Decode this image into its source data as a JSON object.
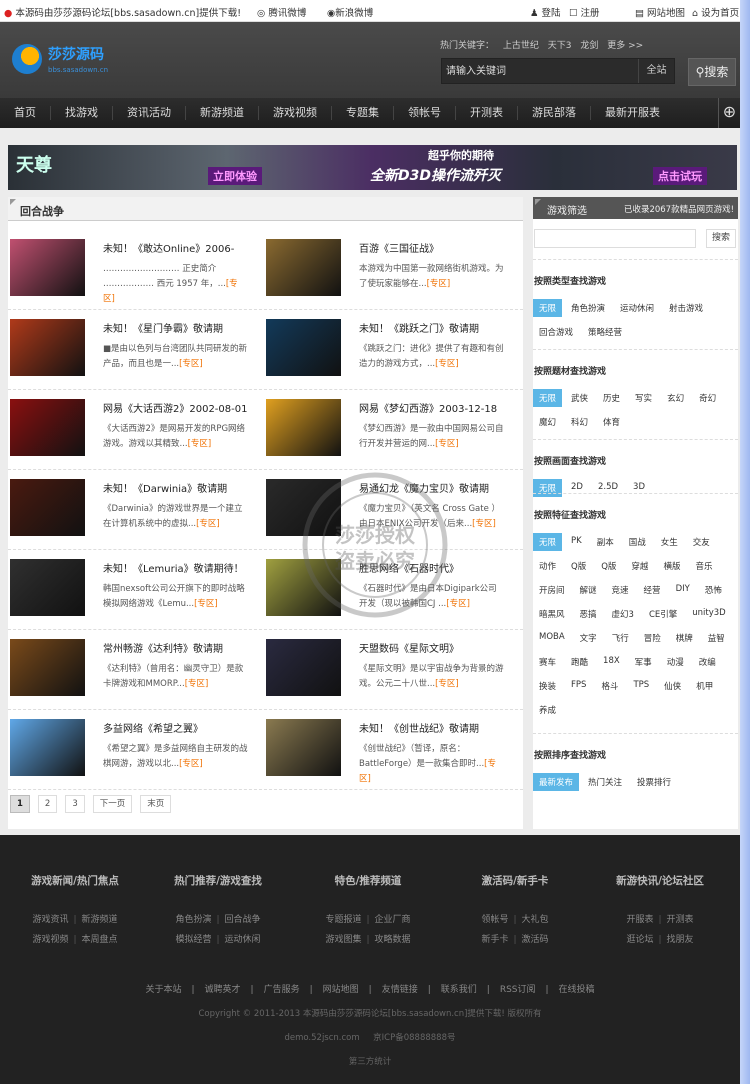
{
  "topbar": {
    "notice": "本源码由莎莎源码论坛[bbs.sasadown.cn]提供下载!",
    "tencent_weibo": "腾讯微博",
    "sina_weibo": "新浪微博",
    "login": "登陆",
    "register": "注册",
    "sitemap": "网站地图",
    "set_home": "设为首页"
  },
  "logo": {
    "name": "莎莎源码",
    "url_text": "bbs.sasadown.cn"
  },
  "hot": {
    "label": "热门关键字：",
    "keywords": [
      "上古世纪",
      "天下3",
      "龙剑"
    ],
    "more": "更多 >>"
  },
  "search": {
    "placeholder": "请输入关键词",
    "scope": "全站",
    "button": "搜索"
  },
  "nav": [
    "首页",
    "找游戏",
    "资讯活动",
    "新游频道",
    "游戏视频",
    "专题集",
    "领帐号",
    "开测表",
    "游民部落",
    "最新开服表"
  ],
  "banner": {
    "logo": "天尊",
    "cta1": "立即体验",
    "headline1": "超乎你的期待",
    "headline2": "全新D3D操作流歼灭",
    "cta2": "点击试玩"
  },
  "section": {
    "title": "回合战争",
    "more_label": "[专区]"
  },
  "games": [
    {
      "title": "未知！《敢达Online》2006-",
      "desc": "……………………… 正史简介 ……………… 西元 1957 年，...",
      "color": "#c05070"
    },
    {
      "title": "百游《三国征战》",
      "desc": "本游戏为中国第一款网络街机游戏。为了使玩家能够在...",
      "color": "#8a6a30"
    },
    {
      "title": "未知！《星门争霸》敬请期",
      "desc": "■是由以色列与台湾团队共同研发的新产品，而且也是一...",
      "color": "#b03a1a"
    },
    {
      "title": "未知！《跳跃之门》敬请期",
      "desc": "《跳跃之门：进化》提供了有趣和有创造力的游戏方式，...",
      "color": "#123a5a"
    },
    {
      "title": "网易《大话西游2》2002-08-01",
      "desc": "《大话西游2》是网易开发的RPG网络游戏。游戏以其精致...",
      "color": "#8a1010"
    },
    {
      "title": "网易《梦幻西游》2003-12-18",
      "desc": "《梦幻西游》是一款由中国网易公司自行开发并营运的网...",
      "color": "#e0a020"
    },
    {
      "title": "未知！《Darwinia》敬请期",
      "desc": "《Darwinia》的游戏世界是一个建立在计算机系统中的虚拟...",
      "color": "#4a1a10"
    },
    {
      "title": "易通幻龙《魔力宝贝》敬请期",
      "desc": "《魔力宝贝》（英文名 Cross Gate ）由日本ENIX公司开发（后来...",
      "color": "#2a2a2a"
    },
    {
      "title": "未知！《Lemuria》敬请期待！",
      "desc": "韩国nexsoft公司公开旗下的即时战略模拟网络游戏《Lemu...",
      "color": "#303030"
    },
    {
      "title": "胜思网络《石器时代》",
      "desc": "《石器时代》是由日本Digipark公司开发（现以被韩国CJ ...",
      "color": "#a0a040"
    },
    {
      "title": "常州畅游《达利特》敬请期",
      "desc": "《达利特》（曾用名：幽灵守卫）是款卡牌游戏和MMORP...",
      "color": "#7a4a1a"
    },
    {
      "title": "天盟数码《星际文明》",
      "desc": "《星际文明》是以宇宙战争为背景的游戏。公元二十八世...",
      "color": "#2a2a40"
    },
    {
      "title": "多益网络《希望之翼》",
      "desc": "《希望之翼》是多益网络自主研发的战棋网游，游戏以北...",
      "color": "#60a8e8"
    },
    {
      "title": "未知！《创世战纪》敬请期",
      "desc": "《创世战纪》（暂译，原名：BattleForge）是一款集合即时...",
      "color": "#8a7a50"
    }
  ],
  "pager": {
    "pages": [
      "1",
      "2",
      "3"
    ],
    "next": "下一页",
    "last": "末页"
  },
  "sidebar": {
    "title": "游戏筛选",
    "count": "已收录2067款精品网页游戏!",
    "search_button": "搜索",
    "groups": [
      {
        "title": "按照类型查找游戏",
        "tags": [
          "无限",
          "角色扮演",
          "运动休闲",
          "射击游戏",
          "回合游戏",
          "策略经营"
        ]
      },
      {
        "title": "按照题材查找游戏",
        "tags": [
          "无限",
          "武侠",
          "历史",
          "写实",
          "玄幻",
          "奇幻",
          "魔幻",
          "科幻",
          "体育"
        ]
      },
      {
        "title": "按照画面查找游戏",
        "tags": [
          "无限",
          "2D",
          "2.5D",
          "3D"
        ]
      },
      {
        "title": "按照特征查找游戏",
        "tags": [
          "无限",
          "PK",
          "副本",
          "国战",
          "女生",
          "交友",
          "动作",
          "Q版",
          "Q版",
          "穿越",
          "横版",
          "音乐",
          "开房间",
          "解谜",
          "竞速",
          "经营",
          "DIY",
          "恐怖",
          "暗黑风",
          "恶搞",
          "虚幻3",
          "CE引擎",
          "unity3D",
          "MOBA",
          "文字",
          "飞行",
          "冒险",
          "棋牌",
          "益智",
          "赛车",
          "跑酷",
          "18X",
          "军事",
          "动漫",
          "改编",
          "换装",
          "FPS",
          "格斗",
          "TPS",
          "仙侠",
          "机甲",
          "养成"
        ]
      },
      {
        "title": "按照排序查找游戏",
        "tags": [
          "最新发布",
          "热门关注",
          "投票排行"
        ]
      }
    ]
  },
  "footer": {
    "cols": [
      {
        "title": "游戏新闻/热门焦点",
        "links": [
          [
            "游戏资讯",
            "新游频道"
          ],
          [
            "游戏视频",
            "本周盘点"
          ]
        ]
      },
      {
        "title": "热门推荐/游戏查找",
        "links": [
          [
            "角色扮演",
            "回合战争"
          ],
          [
            "模拟经营",
            "运动休闲"
          ]
        ]
      },
      {
        "title": "特色/推荐频道",
        "links": [
          [
            "专题报道",
            "企业厂商"
          ],
          [
            "游戏图集",
            "攻略数据"
          ]
        ]
      },
      {
        "title": "激活码/新手卡",
        "links": [
          [
            "领帐号",
            "大礼包"
          ],
          [
            "新手卡",
            "激活码"
          ]
        ]
      },
      {
        "title": "新游快讯/论坛社区",
        "links": [
          [
            "开服表",
            "开测表"
          ],
          [
            "逛论坛",
            "找朋友"
          ]
        ]
      }
    ],
    "links": [
      "关于本站",
      "诚聘英才",
      "广告服务",
      "网站地图",
      "友情链接",
      "联系我们",
      "RSS订阅",
      "在线投稿"
    ],
    "copyright": "Copyright © 2011-2013 本源码由莎莎源码论坛[bbs.sasadown.cn]提供下载! 版权所有",
    "domain": "demo.52jscn.com",
    "icp": "京ICP备08888888号",
    "stats": "第三方统计"
  },
  "watermark": {
    "line1": "莎莎授权",
    "line2": "盗卖必究"
  },
  "colors": {
    "accent": "#5bb6e6",
    "more": "#f07000",
    "footer_bg": "#222222"
  }
}
